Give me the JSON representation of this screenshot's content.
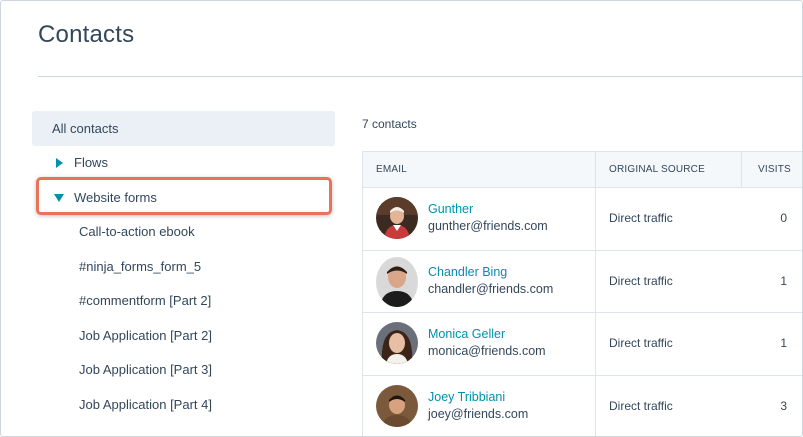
{
  "page": {
    "title": "Contacts"
  },
  "sidebar": {
    "all_contacts": "All contacts",
    "groups": [
      {
        "label": "Flows",
        "expanded": false
      },
      {
        "label": "Website forms",
        "expanded": true
      }
    ],
    "forms": [
      "Call-to-action ebook",
      "#ninja_forms_form_5",
      "#commentform [Part 2]",
      "Job Application [Part 2]",
      "Job Application [Part 3]",
      "Job Application [Part 4]"
    ]
  },
  "main": {
    "count_label": "7 contacts",
    "columns": {
      "email": "EMAIL",
      "source": "ORIGINAL SOURCE",
      "visits": "VISITS"
    },
    "rows": [
      {
        "name": "Gunther",
        "email": "gunther@friends.com",
        "source": "Direct traffic",
        "visits": "0"
      },
      {
        "name": "Chandler Bing",
        "email": "chandler@friends.com",
        "source": "Direct traffic",
        "visits": "1"
      },
      {
        "name": "Monica Geller",
        "email": "monica@friends.com",
        "source": "Direct traffic",
        "visits": "1"
      },
      {
        "name": "Joey Tribbiani",
        "email": "joey@friends.com",
        "source": "Direct traffic",
        "visits": "3"
      }
    ]
  },
  "colors": {
    "accent_link": "#0091ae",
    "text": "#33475b",
    "highlight_border": "#e9735a",
    "selected_bg": "#eaf0f6"
  }
}
